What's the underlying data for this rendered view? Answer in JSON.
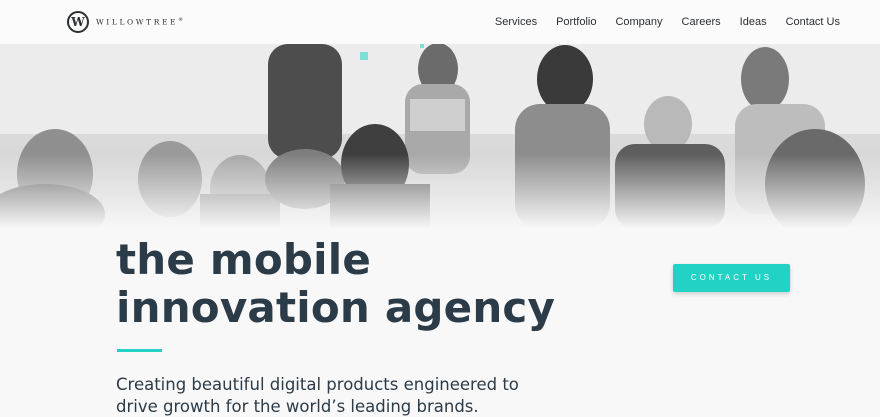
{
  "header": {
    "logo_text": "WILLOWTREE",
    "logo_mark": "W",
    "logo_reg": "®",
    "nav": [
      {
        "label": "Services"
      },
      {
        "label": "Portfolio"
      },
      {
        "label": "Company"
      },
      {
        "label": "Careers"
      },
      {
        "label": "Ideas"
      },
      {
        "label": "Contact Us"
      }
    ]
  },
  "hero": {
    "headline_line1": "the mobile",
    "headline_line2": "innovation agency",
    "tagline_line1": "Creating beautiful digital products engineered to",
    "tagline_line2": "drive growth for the world’s leading brands.",
    "cta_label": "CONTACT US"
  },
  "colors": {
    "accent": "#22d3c5",
    "text": "#2c3b48",
    "background": "#f8f8f8"
  }
}
